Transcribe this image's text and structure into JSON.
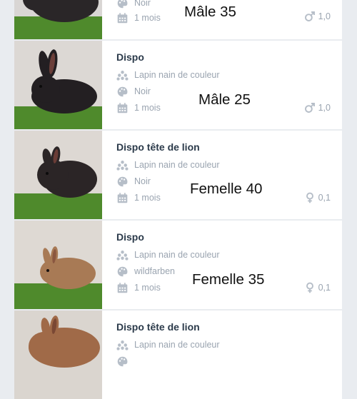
{
  "listings": [
    {
      "title": "",
      "breed": "",
      "color": "Noir",
      "age": "1 mois",
      "price_note": "Mâle 35",
      "sex_symbol": "♂",
      "sex_ratio": "1,0",
      "photo_tone": "#2a2628"
    },
    {
      "title": "Dispo",
      "breed": "Lapin nain de couleur",
      "color": "Noir",
      "age": "1 mois",
      "price_note": "Mâle 25",
      "sex_symbol": "♂",
      "sex_ratio": "1,0",
      "photo_tone": "#231f22"
    },
    {
      "title": "Dispo tête de lion",
      "breed": "Lapin nain de couleur",
      "color": "Noir",
      "age": "1 mois",
      "price_note": "Femelle 40",
      "sex_symbol": "♀",
      "sex_ratio": "0,1",
      "photo_tone": "#2b2526"
    },
    {
      "title": "Dispo",
      "breed": "Lapin nain de couleur",
      "color": "wildfarben",
      "age": "1 mois",
      "price_note": "Femelle 35",
      "sex_symbol": "♀",
      "sex_ratio": "0,1",
      "photo_tone": "#a87a55"
    },
    {
      "title": "Dispo tête de lion",
      "breed": "Lapin nain de couleur",
      "color": "",
      "age": "",
      "price_note": "",
      "sex_symbol": "",
      "sex_ratio": "",
      "photo_tone": "#a06a48"
    }
  ],
  "icons": {
    "breed": "paw-icon",
    "color": "palette-icon",
    "age": "calendar-icon"
  },
  "colors": {
    "background": "#e9ecf0",
    "card": "#ffffff",
    "title": "#2b3a4a",
    "meta": "#9aa4b0",
    "icon": "#b6bec8",
    "grass": "#4f8a2c"
  }
}
